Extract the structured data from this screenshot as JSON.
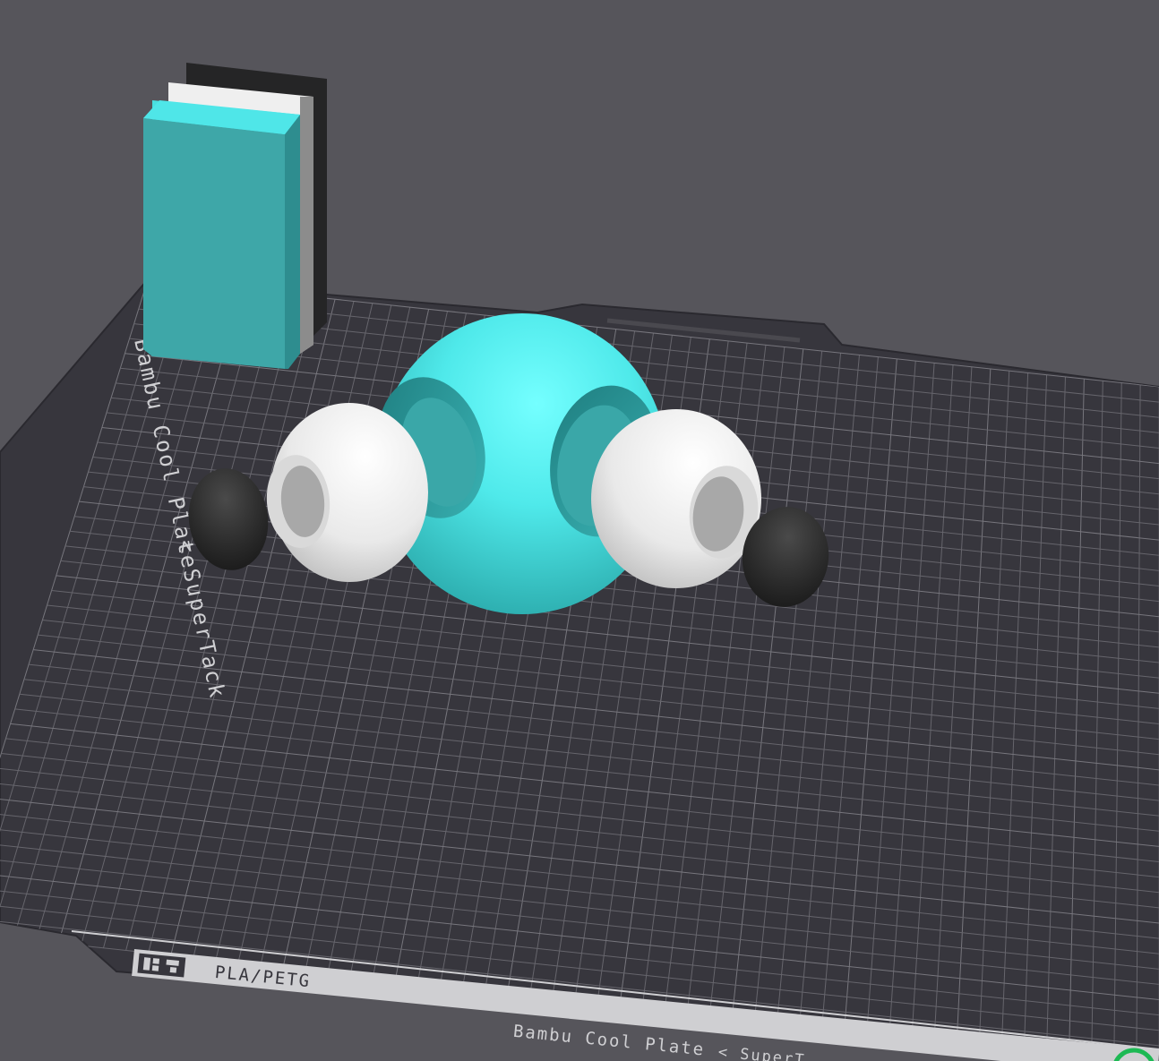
{
  "viewport": {
    "background": "#56555b"
  },
  "plate": {
    "color": "#37363d",
    "grid_color": "#6a6970",
    "label_left": "Bambu Cool Plate",
    "label_left_suffix": "< SuperTack",
    "label_bottom_material": "PLA/PETG",
    "label_bottom_name": "Bambu Cool Plate",
    "label_bottom_suffix": "< SuperT"
  },
  "objects": [
    {
      "name": "filament-block",
      "colors": [
        "#3ea8a8",
        "#f2f2f2",
        "#2a2a2a"
      ]
    },
    {
      "name": "center-sphere",
      "color": "#45e6e6"
    },
    {
      "name": "left-eye",
      "color": "#f4f4f4"
    },
    {
      "name": "right-eye",
      "color": "#f4f4f4"
    },
    {
      "name": "left-pupil",
      "color": "#242424"
    },
    {
      "name": "right-pupil",
      "color": "#242424"
    }
  ],
  "status": {
    "indicator_color": "#1db954"
  }
}
